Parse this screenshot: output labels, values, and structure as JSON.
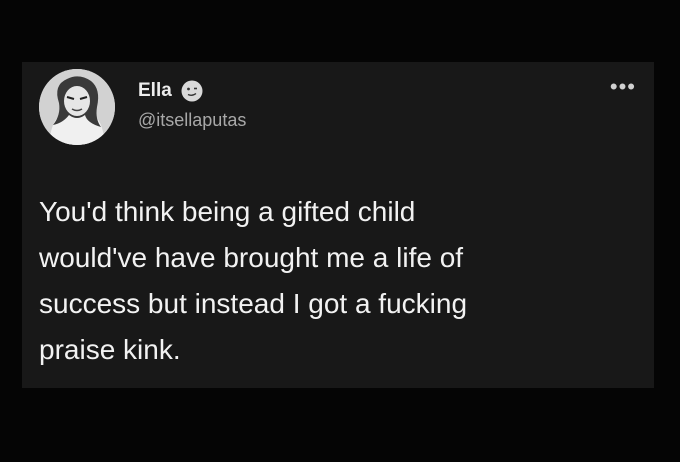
{
  "tweet": {
    "display_name": "Ella",
    "handle": "@itsellaputas",
    "more_icon": "more-horizontal-icon",
    "badge_icon": "face-emoji-icon",
    "text": "You'd think being a gifted child\nwould've have brought me a life of\nsuccess but instead I got a fucking\npraise kink."
  },
  "colors": {
    "background": "#050505",
    "card": "#181818",
    "text": "#f2f2f2",
    "secondary_text": "#a8a8a8"
  }
}
